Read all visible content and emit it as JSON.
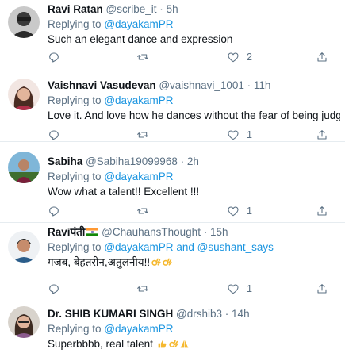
{
  "tweets": [
    {
      "name": "Ravi Ratan",
      "handle": "@scribe_it",
      "dot": "·",
      "time": "5h",
      "replying_prefix": "Replying to",
      "replying_to": "@dayakamPR",
      "text": "Such an elegant dance and expression",
      "reply_count": "",
      "retweet_count": "",
      "like_count": "2"
    },
    {
      "name": "Vaishnavi Vasudevan",
      "handle": "@vaishnavi_1001",
      "dot": "·",
      "time": "11h",
      "replying_prefix": "Replying to",
      "replying_to": "@dayakamPR",
      "text": "Love it. And love how he dances without the fear of being judged..",
      "reply_count": "",
      "retweet_count": "",
      "like_count": "1"
    },
    {
      "name": "Sabiha",
      "handle": "@Sabiha19099968",
      "dot": "·",
      "time": "2h",
      "replying_prefix": "Replying to",
      "replying_to": "@dayakamPR",
      "text": "Wow what a talent!! Excellent !!!",
      "reply_count": "",
      "retweet_count": "",
      "like_count": "1"
    },
    {
      "name": "Raviपंती",
      "handle": "@ChauhansThought",
      "dot": "·",
      "time": "15h",
      "replying_prefix": "Replying to",
      "replying_to": "@dayakamPR",
      "replying_and": "and",
      "replying_to_2": "@sushant_says",
      "text": "गजब, बेहतरीन,अतुलनीय!!",
      "reply_count": "",
      "retweet_count": "",
      "like_count": "1"
    },
    {
      "name": "Dr. SHIB KUMARI SINGH",
      "handle": "@drshib3",
      "dot": "·",
      "time": "14h",
      "replying_prefix": "Replying to",
      "replying_to": "@dayakamPR",
      "text": "Superbbbb, real talent"
    }
  ],
  "icons": {
    "reply": "reply-icon",
    "retweet": "retweet-icon",
    "like": "heart-icon",
    "share": "share-icon"
  },
  "colors": {
    "mention": "#1b95e0",
    "secondary": "#5b7083",
    "divider": "#e6ecf0"
  }
}
